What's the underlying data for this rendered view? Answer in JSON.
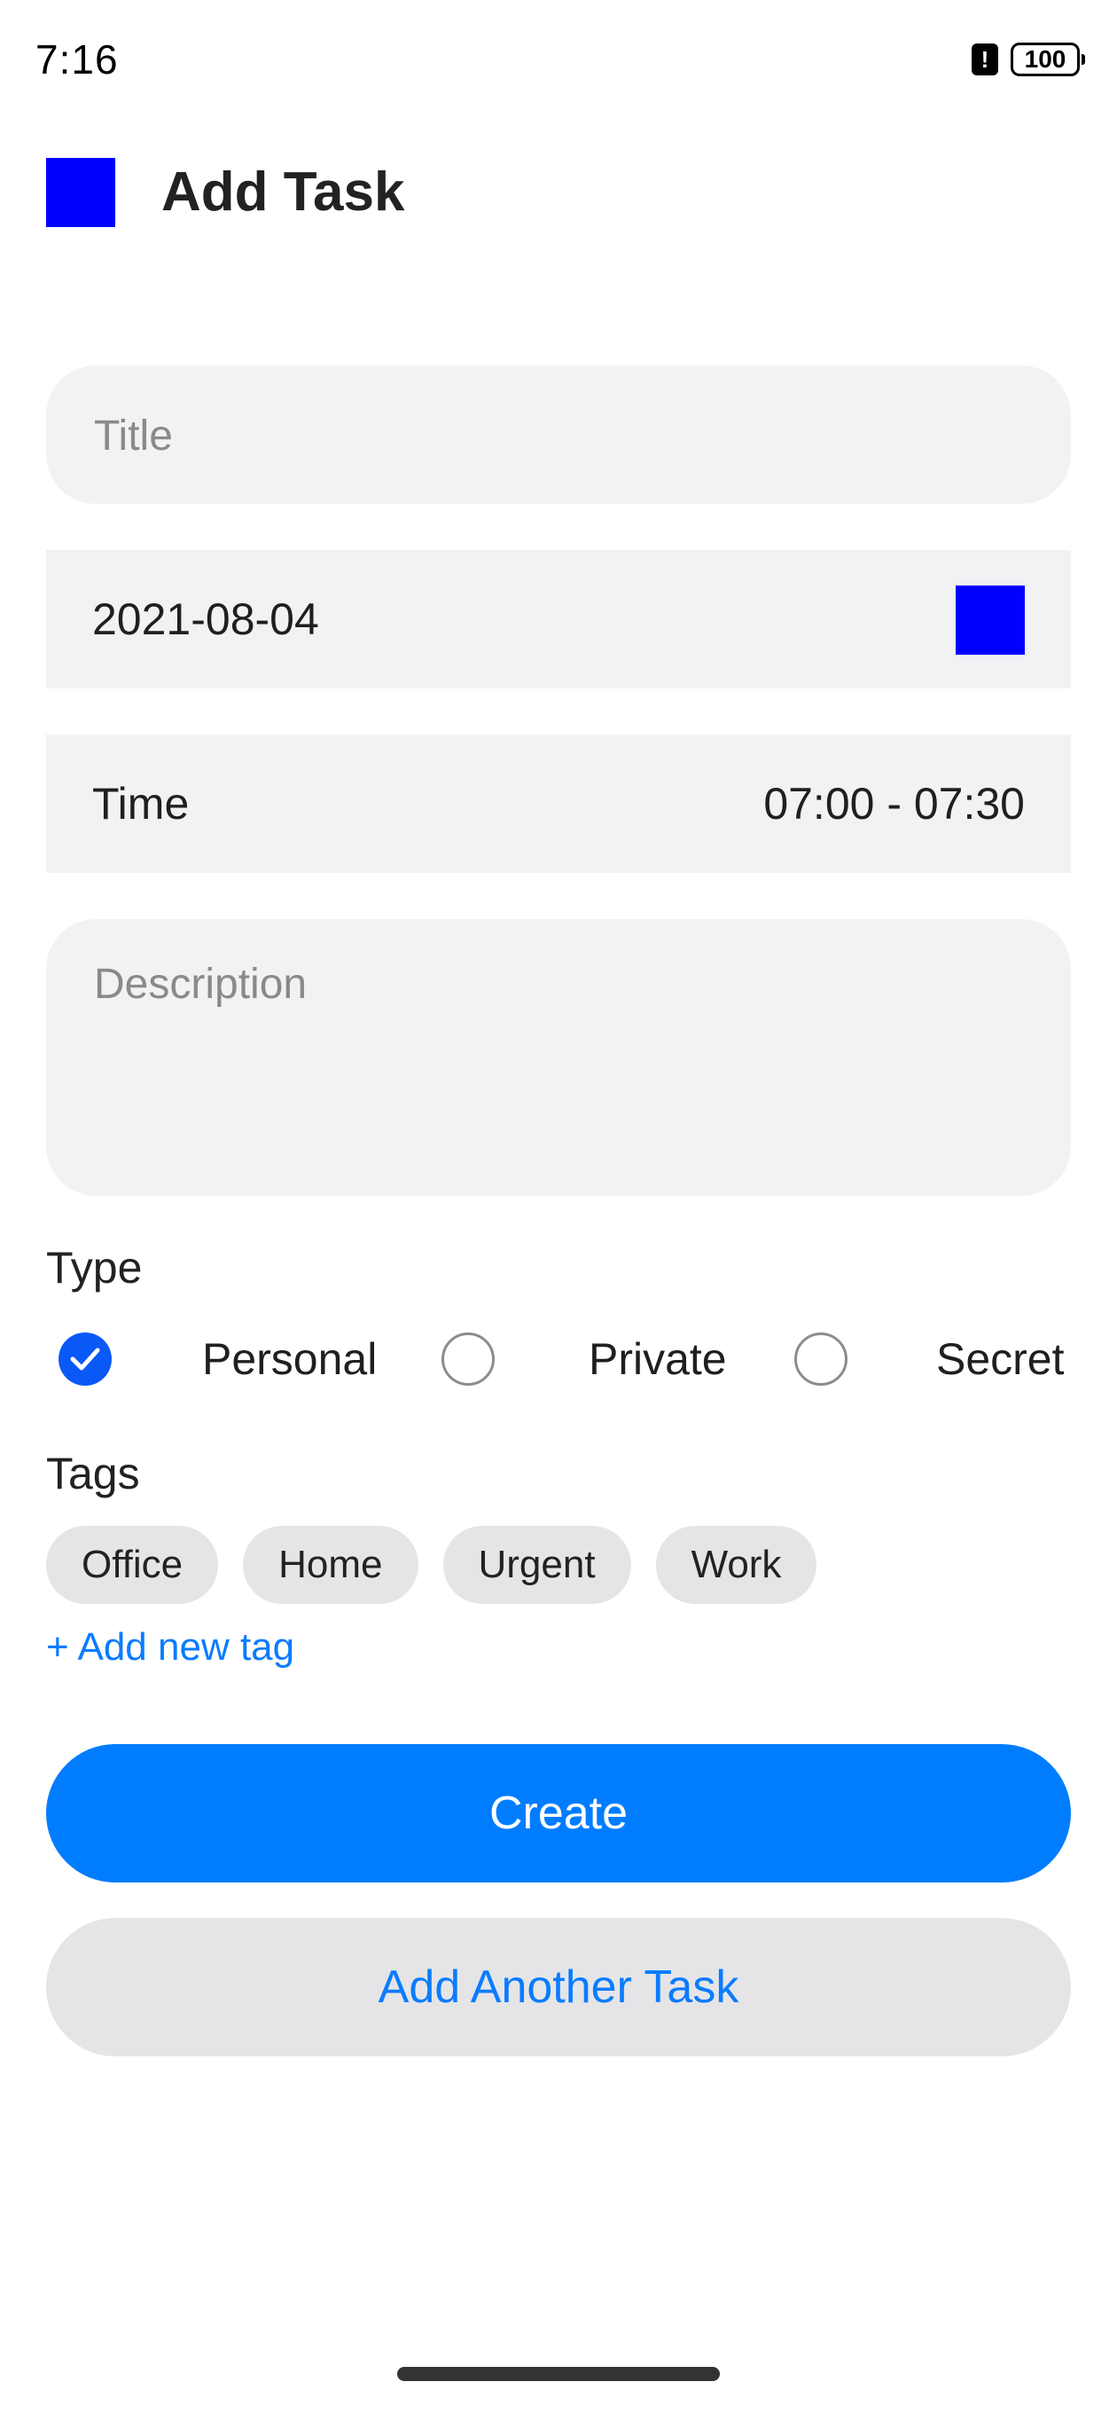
{
  "status_bar": {
    "time": "7:16",
    "alert_glyph": "!",
    "battery": "100"
  },
  "header": {
    "title": "Add Task",
    "logo_color": "#0000ff"
  },
  "form": {
    "title_placeholder": "Title",
    "title_value": "",
    "date_value": "2021-08-04",
    "time_label": "Time",
    "time_value": "07:00 - 07:30",
    "description_placeholder": "Description",
    "description_value": ""
  },
  "type_section": {
    "label": "Type",
    "options": [
      {
        "label": "Personal",
        "checked": true
      },
      {
        "label": "Private",
        "checked": false
      },
      {
        "label": "Secret",
        "checked": false
      }
    ]
  },
  "tags_section": {
    "label": "Tags",
    "tags": [
      "Office",
      "Home",
      "Urgent",
      "Work"
    ],
    "add_link": "+ Add new tag"
  },
  "buttons": {
    "create": "Create",
    "add_another": "Add Another Task"
  },
  "colors": {
    "primary": "#007dff",
    "link": "#0a7cff",
    "radio_checked": "#0a59f7",
    "field_bg": "#f1f2f4",
    "chip_bg": "#e5e5e7"
  }
}
